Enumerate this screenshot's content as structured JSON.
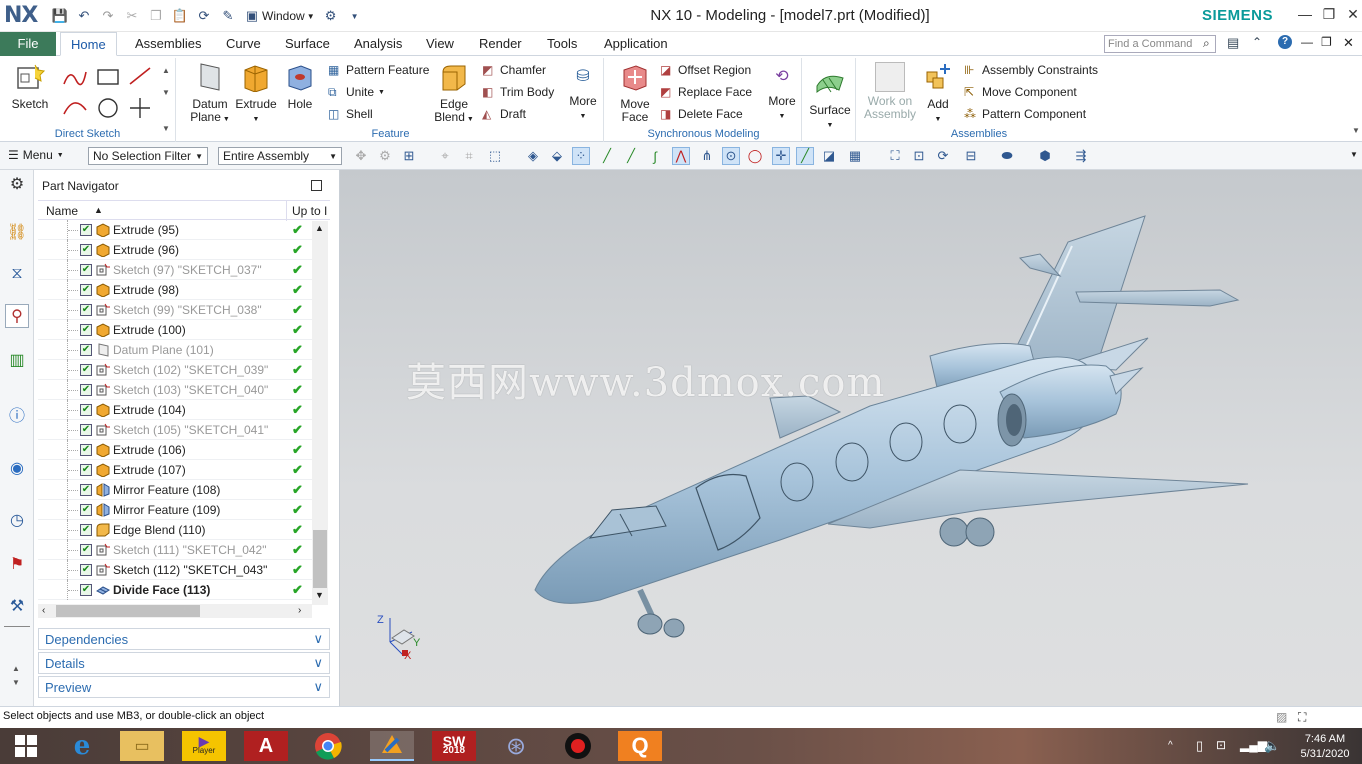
{
  "app": {
    "logo": "NX",
    "window_title": "NX 10 - Modeling - [model7.prt (Modified)]",
    "brand": "SIEMENS",
    "quick_access_window": "Window",
    "find_command_placeholder": "Find a Command"
  },
  "tabs": [
    {
      "label": "File"
    },
    {
      "label": "Home",
      "active": true
    },
    {
      "label": "Assemblies"
    },
    {
      "label": "Curve"
    },
    {
      "label": "Surface"
    },
    {
      "label": "Analysis"
    },
    {
      "label": "View"
    },
    {
      "label": "Render"
    },
    {
      "label": "Tools"
    },
    {
      "label": "Application"
    }
  ],
  "ribbon": {
    "direct_sketch": {
      "label": "Direct Sketch",
      "sketch": "Sketch"
    },
    "feature": {
      "label": "Feature",
      "datum_plane": "Datum Plane",
      "extrude": "Extrude",
      "hole": "Hole",
      "pattern_feature": "Pattern Feature",
      "unite": "Unite",
      "shell": "Shell",
      "edge_blend": "Edge Blend",
      "chamfer": "Chamfer",
      "trim_body": "Trim Body",
      "draft": "Draft",
      "more": "More"
    },
    "sync": {
      "label": "Synchronous Modeling",
      "move_face": "Move Face",
      "offset_region": "Offset Region",
      "replace_face": "Replace Face",
      "delete_face": "Delete Face",
      "more": "More"
    },
    "surface": {
      "label": "Surface"
    },
    "assemblies": {
      "label": "Assemblies",
      "work_on_assembly": "Work on Assembly",
      "add": "Add",
      "assembly_constraints": "Assembly Constraints",
      "move_component": "Move Component",
      "pattern_component": "Pattern Component"
    }
  },
  "selbar": {
    "menu": "Menu",
    "filter": "No Selection Filter",
    "scope": "Entire Assembly"
  },
  "navigator": {
    "title": "Part Navigator",
    "col_name": "Name",
    "col_uptodate": "Up to I",
    "rows": [
      {
        "label": "Extrude (95)",
        "kind": "extrude",
        "grey": false
      },
      {
        "label": "Extrude (96)",
        "kind": "extrude",
        "grey": false
      },
      {
        "label": "Sketch (97) \"SKETCH_037\"",
        "kind": "sketch",
        "grey": true
      },
      {
        "label": "Extrude (98)",
        "kind": "extrude",
        "grey": false
      },
      {
        "label": "Sketch (99) \"SKETCH_038\"",
        "kind": "sketch",
        "grey": true
      },
      {
        "label": "Extrude (100)",
        "kind": "extrude",
        "grey": false
      },
      {
        "label": "Datum Plane (101)",
        "kind": "datum",
        "grey": true
      },
      {
        "label": "Sketch (102) \"SKETCH_039\"",
        "kind": "sketch",
        "grey": true
      },
      {
        "label": "Sketch (103) \"SKETCH_040\"",
        "kind": "sketch",
        "grey": true
      },
      {
        "label": "Extrude (104)",
        "kind": "extrude",
        "grey": false
      },
      {
        "label": "Sketch (105) \"SKETCH_041\"",
        "kind": "sketch",
        "grey": true
      },
      {
        "label": "Extrude (106)",
        "kind": "extrude",
        "grey": false
      },
      {
        "label": "Extrude (107)",
        "kind": "extrude",
        "grey": false
      },
      {
        "label": "Mirror Feature (108)",
        "kind": "mirror",
        "grey": false
      },
      {
        "label": "Mirror Feature (109)",
        "kind": "mirror",
        "grey": false
      },
      {
        "label": "Edge Blend (110)",
        "kind": "blend",
        "grey": false
      },
      {
        "label": "Sketch (111) \"SKETCH_042\"",
        "kind": "sketch",
        "grey": true
      },
      {
        "label": "Sketch (112) \"SKETCH_043\"",
        "kind": "sketch",
        "grey": false
      },
      {
        "label": "Divide Face (113)",
        "kind": "divide",
        "grey": false,
        "bold": true
      }
    ],
    "panels": {
      "dependencies": "Dependencies",
      "details": "Details",
      "preview": "Preview"
    }
  },
  "viewport": {
    "watermark": "莫西网www.3dmox.com",
    "axis_z": "Z",
    "axis_y": "Y",
    "axis_x": "X"
  },
  "status": {
    "text": "Select objects and use MB3, or double-click an object"
  },
  "taskbar": {
    "solidworks_year": "2018",
    "player_label": "Player",
    "time": "7:46 AM",
    "date": "5/31/2020"
  },
  "colors": {
    "accent": "#1c5aa8",
    "file_tab": "#3c7a5a",
    "model": "#a9c4db",
    "brand": "#0a9a9a"
  }
}
